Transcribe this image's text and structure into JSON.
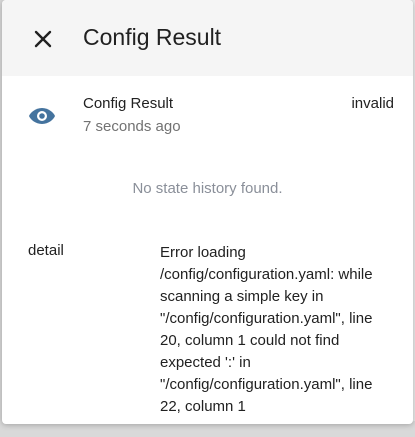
{
  "dialog": {
    "title": "Config Result",
    "close_icon": "close-icon"
  },
  "entity": {
    "icon": "eye-icon",
    "icon_color": "#44739e",
    "name": "Config Result",
    "last_changed": "7 seconds ago",
    "state": "invalid"
  },
  "history": {
    "empty_message": "No state history found."
  },
  "attributes": [
    {
      "key": "detail",
      "value": "Error loading /config/configuration.yaml: while scanning a simple key in \"/config/configuration.yaml\", line 20, column 1 could not find expected ':' in \"/config/configuration.yaml\", line 22, column 1"
    }
  ]
}
